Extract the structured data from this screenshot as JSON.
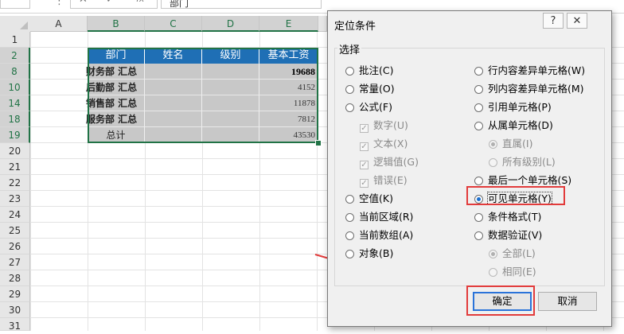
{
  "topbar": {
    "fx_label": "fx",
    "namebox_fragment": "部门"
  },
  "sheet": {
    "columns": [
      "A",
      "B",
      "C",
      "D",
      "E"
    ],
    "rows": [
      "1",
      "2",
      "8",
      "10",
      "14",
      "18",
      "19",
      "20",
      "21",
      "22",
      "23",
      "24",
      "25",
      "26",
      "27",
      "28",
      "29",
      "30",
      "31"
    ],
    "headers": [
      "部门",
      "姓名",
      "级别",
      "基本工资"
    ],
    "data_rows": [
      {
        "dept": "财务部 汇总",
        "value": "19688",
        "bold": true
      },
      {
        "dept": "后勤部 汇总",
        "value": "4152",
        "bold": false
      },
      {
        "dept": "销售部 汇总",
        "value": "11878",
        "bold": false
      },
      {
        "dept": "服务部 汇总",
        "value": "7812",
        "bold": false
      },
      {
        "dept": "总计",
        "value": "43530",
        "bold": false
      }
    ]
  },
  "dialog": {
    "title": "定位条件",
    "help_glyph": "?",
    "close_glyph": "✕",
    "group_label": "选择",
    "left_options": [
      {
        "label": "批注(C)",
        "type": "radio",
        "disabled": false,
        "checked": false
      },
      {
        "label": "常量(O)",
        "type": "radio",
        "disabled": false,
        "checked": false
      },
      {
        "label": "公式(F)",
        "type": "radio",
        "disabled": false,
        "checked": false
      },
      {
        "label": "数字(U)",
        "type": "checkbox",
        "disabled": true,
        "checked": true
      },
      {
        "label": "文本(X)",
        "type": "checkbox",
        "disabled": true,
        "checked": true
      },
      {
        "label": "逻辑值(G)",
        "type": "checkbox",
        "disabled": true,
        "checked": true
      },
      {
        "label": "错误(E)",
        "type": "checkbox",
        "disabled": true,
        "checked": true
      },
      {
        "label": "空值(K)",
        "type": "radio",
        "disabled": false,
        "checked": false
      },
      {
        "label": "当前区域(R)",
        "type": "radio",
        "disabled": false,
        "checked": false
      },
      {
        "label": "当前数组(A)",
        "type": "radio",
        "disabled": false,
        "checked": false
      },
      {
        "label": "对象(B)",
        "type": "radio",
        "disabled": false,
        "checked": false
      }
    ],
    "right_options": [
      {
        "label": "行内容差异单元格(W)",
        "type": "radio",
        "disabled": false,
        "checked": false
      },
      {
        "label": "列内容差异单元格(M)",
        "type": "radio",
        "disabled": false,
        "checked": false
      },
      {
        "label": "引用单元格(P)",
        "type": "radio",
        "disabled": false,
        "checked": false
      },
      {
        "label": "从属单元格(D)",
        "type": "radio",
        "disabled": false,
        "checked": false
      },
      {
        "label": "直属(I)",
        "type": "radio",
        "disabled": true,
        "checked": true
      },
      {
        "label": "所有级别(L)",
        "type": "radio",
        "disabled": true,
        "checked": false
      },
      {
        "label": "最后一个单元格(S)",
        "type": "radio",
        "disabled": false,
        "checked": false
      },
      {
        "label": "可见单元格(Y)",
        "type": "radio",
        "disabled": false,
        "checked": true
      },
      {
        "label": "条件格式(T)",
        "type": "radio",
        "disabled": false,
        "checked": false
      },
      {
        "label": "数据验证(V)",
        "type": "radio",
        "disabled": false,
        "checked": false
      },
      {
        "label": "全部(L)",
        "type": "radio",
        "disabled": true,
        "checked": true
      },
      {
        "label": "相同(E)",
        "type": "radio",
        "disabled": true,
        "checked": false
      }
    ],
    "ok_label": "确定",
    "cancel_label": "取消"
  },
  "colors": {
    "header_blue": "#1f6fb5",
    "selection_green": "#217346",
    "annotation_red": "#e23b3b",
    "radio_blue": "#1a6fd0"
  }
}
